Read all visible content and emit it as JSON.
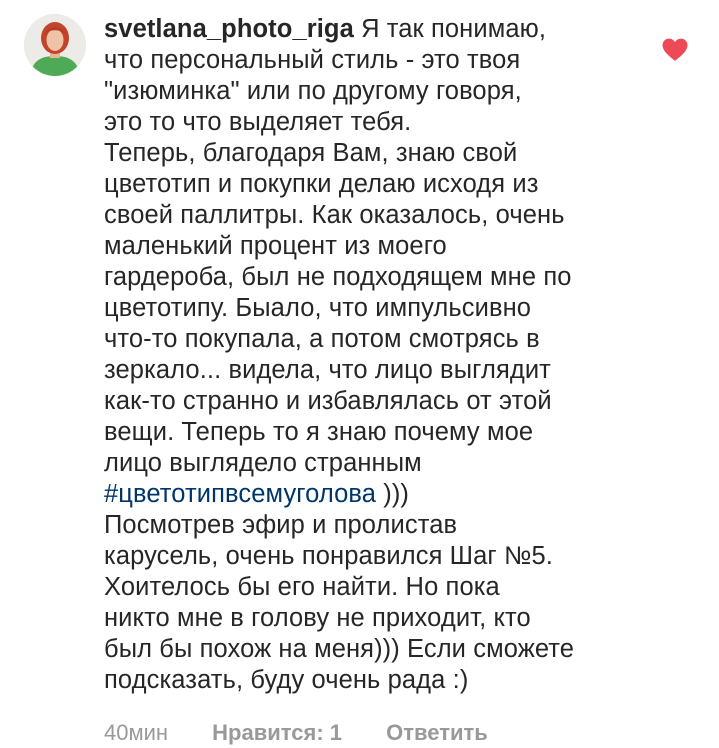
{
  "comment": {
    "username": "svetlana_photo_riga",
    "text_first": " Я так понимаю,\nчто персональный стиль - это твоя\n\"изюминка\" или по другому говоря,\nэто то что выделяет тебя.\nТеперь, благодаря Вам, знаю свой\nцветотип и покупки делаю исходя из\nсвоей паллитры. Как оказалось, очень\nмаленький процент из моего\nгардероба, был не подходящем мне по\nцветотипу. Быало, что импульсивно\nчто-то покупала, а потом смотрясь в\nзеркало... видела, что лицо выглядит\nкак-то странно и избавлялась от этой\nвещи. Теперь то я знаю почему мое\nлицо выглядело странным\n",
    "hashtag": "#цветотипвсемуголова",
    "text_after_hashtag": " )))",
    "text_second": "Посмотрев эфир и пролистав\nкарусель, очень понравился Шаг №5.\nХоителось бы его найти. Но пока\nникто мне в голову не приходит, кто\nбыл бы похож на меня))) Если сможете\nподсказать, буду очень рада :)",
    "liked": true
  },
  "meta": {
    "time": "40мин",
    "likes": "Нравится: 1",
    "reply": "Ответить"
  },
  "colors": {
    "text": "#262626",
    "hashtag": "#003569",
    "like_heart": "#ed4956",
    "meta": "#999999"
  },
  "icons": {
    "avatar": "user-avatar",
    "like": "heart-icon"
  }
}
